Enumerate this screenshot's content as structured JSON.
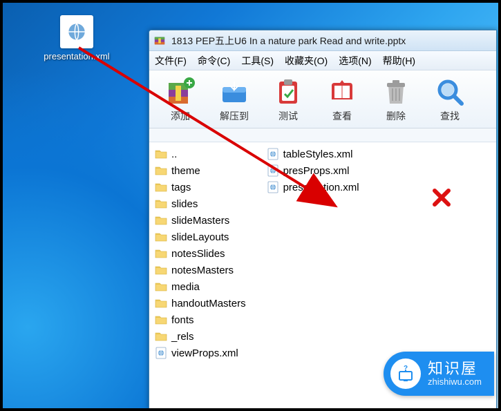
{
  "desktop_icon": {
    "label": "presentation.xml"
  },
  "winrar": {
    "title": "1813 PEP五上U6 In a nature park Read and write.pptx",
    "menus": {
      "file": "文件(F)",
      "command": "命令(C)",
      "tools": "工具(S)",
      "fav": "收藏夹(O)",
      "options": "选项(N)",
      "help": "帮助(H)"
    },
    "toolbar": {
      "add": "添加",
      "extract": "解压到",
      "test": "测试",
      "view": "查看",
      "delete": "删除",
      "find": "查找"
    },
    "files_left": [
      {
        "name": "..",
        "type": "folder"
      },
      {
        "name": "theme",
        "type": "folder"
      },
      {
        "name": "tags",
        "type": "folder"
      },
      {
        "name": "slides",
        "type": "folder"
      },
      {
        "name": "slideMasters",
        "type": "folder"
      },
      {
        "name": "slideLayouts",
        "type": "folder"
      },
      {
        "name": "notesSlides",
        "type": "folder"
      },
      {
        "name": "notesMasters",
        "type": "folder"
      },
      {
        "name": "media",
        "type": "folder"
      },
      {
        "name": "handoutMasters",
        "type": "folder"
      },
      {
        "name": "fonts",
        "type": "folder"
      },
      {
        "name": "_rels",
        "type": "folder"
      },
      {
        "name": "viewProps.xml",
        "type": "xml"
      }
    ],
    "files_right": [
      {
        "name": "tableStyles.xml",
        "type": "xml"
      },
      {
        "name": "presProps.xml",
        "type": "xml"
      },
      {
        "name": "presentation.xml",
        "type": "xml"
      }
    ]
  },
  "badge": {
    "title": "知识屋",
    "sub": "zhishiwu.com"
  }
}
